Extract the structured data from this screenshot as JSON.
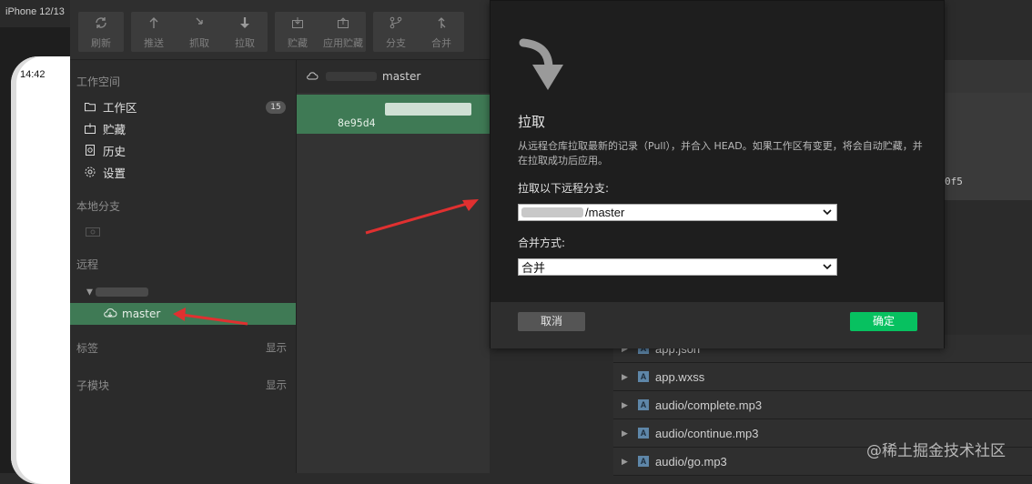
{
  "simulator": {
    "device_label": "iPhone 12/13",
    "status_time": "14:42"
  },
  "toolbar": {
    "items": [
      {
        "label": "刷新",
        "icon": "refresh-icon"
      },
      {
        "label": "推送",
        "icon": "push-icon"
      },
      {
        "label": "抓取",
        "icon": "fetch-icon"
      },
      {
        "label": "拉取",
        "icon": "pull-icon"
      },
      {
        "label": "贮藏",
        "icon": "stash-icon"
      },
      {
        "label": "应用贮藏",
        "icon": "apply-stash-icon"
      },
      {
        "label": "分支",
        "icon": "branch-icon"
      },
      {
        "label": "合并",
        "icon": "merge-icon"
      }
    ]
  },
  "sidebar": {
    "workspace_title": "工作空间",
    "workspace_items": [
      {
        "label": "工作区",
        "icon": "folder-icon",
        "badge": "15"
      },
      {
        "label": "贮藏",
        "icon": "stash-icon"
      },
      {
        "label": "历史",
        "icon": "history-icon"
      },
      {
        "label": "设置",
        "icon": "gear-icon"
      }
    ],
    "local_branch_title": "本地分支",
    "remote_title": "远程",
    "remote_branch": "master",
    "tags_title": "标签",
    "tags_action": "显示",
    "submodule_title": "子模块",
    "submodule_action": "显示"
  },
  "commits": {
    "header_branch": "master",
    "selected_hash": "8e95d4"
  },
  "files": {
    "hash_fragment": "0f5",
    "items": [
      {
        "name": "app.json",
        "type": "A"
      },
      {
        "name": "app.wxss",
        "type": "A"
      },
      {
        "name": "audio/complete.mp3",
        "type": "A"
      },
      {
        "name": "audio/continue.mp3",
        "type": "A"
      },
      {
        "name": "audio/go.mp3",
        "type": "A"
      }
    ]
  },
  "dialog": {
    "title": "拉取",
    "description": "从远程仓库拉取最新的记录（Pull），并合入 HEAD。如果工作区有变更，将会自动贮藏，并在拉取成功后应用。",
    "branch_label": "拉取以下远程分支:",
    "branch_value": "/master",
    "merge_label": "合并方式:",
    "merge_value": "合并",
    "cancel_label": "取消",
    "ok_label": "确定",
    "accent_color": "#07c160"
  },
  "watermark": "@稀土掘金技术社区"
}
